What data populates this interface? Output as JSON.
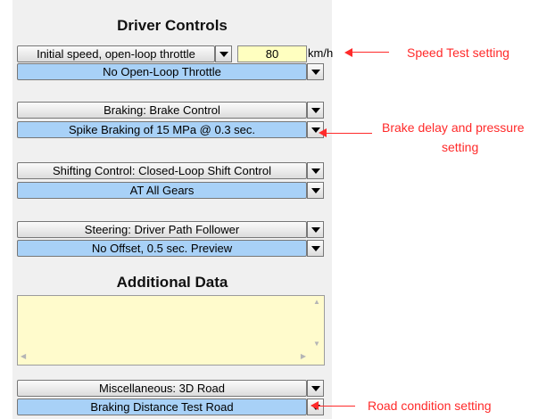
{
  "driver_controls": {
    "title": "Driver Controls",
    "speed": {
      "label": "Initial speed, open-loop throttle",
      "value": "80",
      "unit": "km/h"
    },
    "throttle": "No Open-Loop Throttle",
    "braking": {
      "label": "Braking: Brake Control",
      "value": "Spike Braking of 15 MPa @ 0.3 sec."
    },
    "shifting": {
      "label": "Shifting Control: Closed-Loop Shift Control",
      "value": "AT All Gears"
    },
    "steering": {
      "label": "Steering: Driver Path Follower",
      "value": "No Offset, 0.5 sec. Preview"
    }
  },
  "additional_data": {
    "title": "Additional Data",
    "text": ""
  },
  "misc": {
    "label": "Miscellaneous: 3D Road",
    "value": "Braking Distance Test Road"
  },
  "annotations": {
    "speed": "Speed Test setting",
    "brake_line1": "Brake delay and pressure",
    "brake_line2": "setting",
    "road": "Road condition setting"
  },
  "colors": {
    "annotation": "#ff2a2a",
    "selected_combo": "#a8d1f7",
    "memo_bg": "#fffbcc",
    "speed_field_bg": "#ffffc0"
  }
}
